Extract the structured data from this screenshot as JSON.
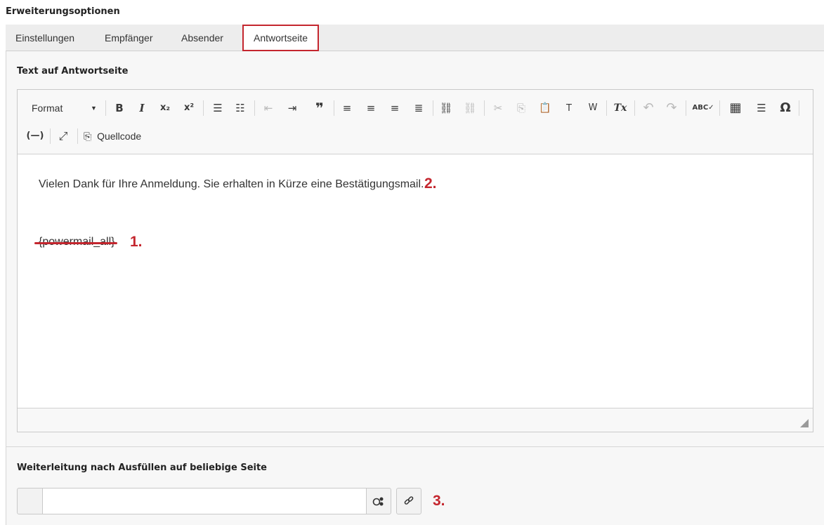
{
  "section": {
    "title": "Erweiterungsoptionen"
  },
  "tabs": [
    {
      "label": "Einstellungen"
    },
    {
      "label": "Empfänger"
    },
    {
      "label": "Absender"
    },
    {
      "label": "Antwortseite",
      "active": true
    }
  ],
  "editor_section": {
    "label": "Text auf Antwortseite"
  },
  "toolbar": {
    "format_label": "Format",
    "source_label": "Quellcode",
    "icons": {
      "bold": "B",
      "italic": "I",
      "subscript": "x₂",
      "superscript": "x²",
      "ordered_list": "☰",
      "bullet_list": "☷",
      "outdent": "⇤",
      "indent": "⇥",
      "blockquote": "❞",
      "align_left": "≡",
      "align_center": "≡",
      "align_right": "≡",
      "justify": "≣",
      "link": "⛓",
      "unlink": "⛓",
      "cut": "✂",
      "copy": "⎘",
      "paste": "📋",
      "paste_text": "T",
      "paste_word": "W",
      "remove_format": "Tx",
      "undo": "↶",
      "redo": "↷",
      "spellcheck": "ABC✓",
      "table": "▦",
      "horizontal_rule": "☰",
      "special_char": "Ω",
      "placeholder": "(—)",
      "maximize": "⤢",
      "source_icon": "⎘"
    }
  },
  "content": {
    "line1": "Vielen Dank für Ihre Anmeldung. Sie erhalten in Kürze eine Bestätigungsmail.",
    "line2": "{powermail_all}"
  },
  "annotations": {
    "a1": "1.",
    "a2": "2.",
    "a3": "3."
  },
  "redirect_section": {
    "label": "Weiterleitung nach Ausfüllen auf beliebige Seite",
    "value": ""
  },
  "colors": {
    "accent_red": "#c4262e",
    "tab_bg": "#ededed",
    "panel_bg": "#f7f7f7"
  }
}
